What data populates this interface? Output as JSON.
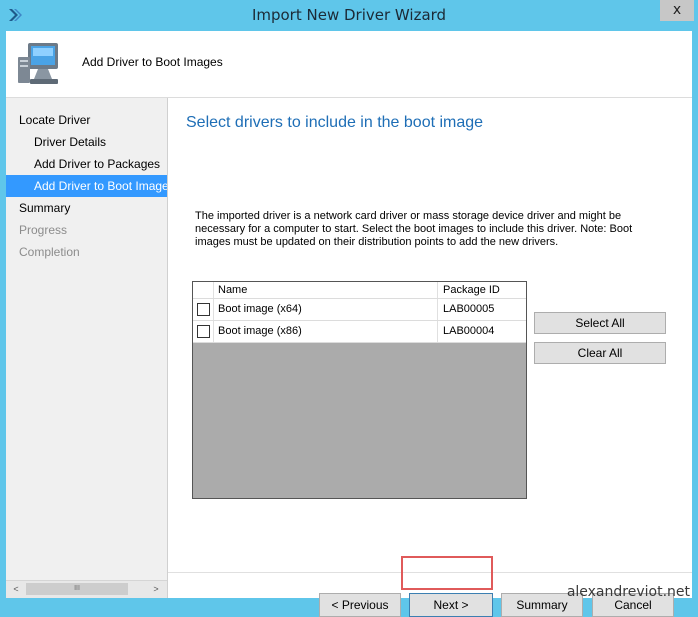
{
  "window": {
    "title": "Import New Driver Wizard",
    "close_glyph": "x"
  },
  "header": {
    "icon": "computer-monitor-icon",
    "title": "Add Driver to Boot Images"
  },
  "nav": {
    "items": [
      {
        "label": "Locate Driver",
        "level": 0,
        "state": "normal"
      },
      {
        "label": "Driver Details",
        "level": 1,
        "state": "normal"
      },
      {
        "label": "Add Driver to Packages",
        "level": 1,
        "state": "normal"
      },
      {
        "label": "Add Driver to Boot Images",
        "level": 1,
        "state": "active"
      },
      {
        "label": "Summary",
        "level": 0,
        "state": "normal"
      },
      {
        "label": "Progress",
        "level": 0,
        "state": "disabled"
      },
      {
        "label": "Completion",
        "level": 0,
        "state": "disabled"
      }
    ],
    "scroll_left": "<",
    "scroll_right": ">",
    "scroll_grip": "III"
  },
  "main": {
    "heading": "Select drivers to include in the boot image",
    "description": "The imported driver is a network card driver or mass storage device driver and might be necessary for a computer to start. Select the boot images to include this driver.  Note: Boot images must be updated on their distribution points to add the new drivers.",
    "grid": {
      "columns": [
        "Name",
        "Package ID"
      ],
      "rows": [
        {
          "name": "Boot image (x64)",
          "package_id": "LAB00005",
          "checked": false
        },
        {
          "name": "Boot image (x86)",
          "package_id": "LAB00004",
          "checked": false
        }
      ]
    },
    "select_all_label": "Select All",
    "clear_all_label": "Clear All"
  },
  "footer": {
    "previous_label": "< Previous",
    "next_label": "Next >",
    "summary_label": "Summary",
    "cancel_label": "Cancel"
  },
  "watermark": "alexandreviot.net",
  "colors": {
    "frame": "#5fc6ea",
    "active_nav": "#3399ff",
    "heading": "#1e6eb6",
    "highlight": "#e05a5a"
  }
}
